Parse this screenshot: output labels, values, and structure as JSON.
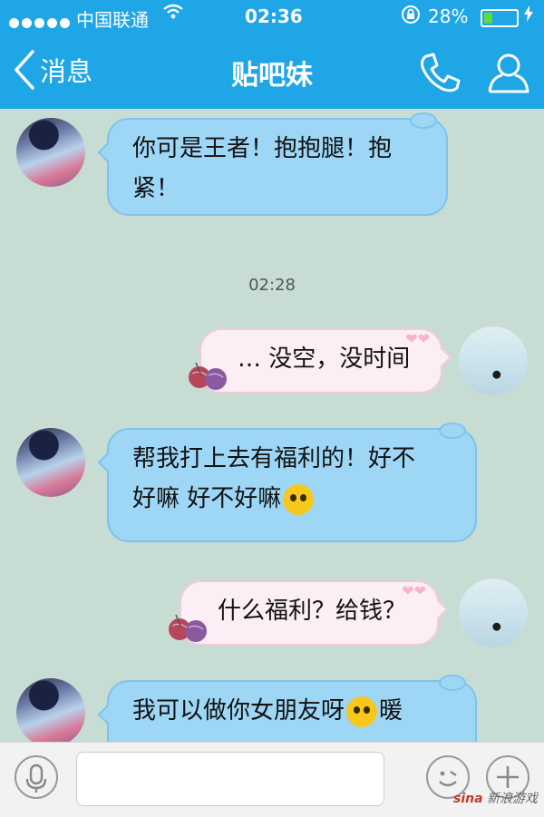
{
  "status_bar": {
    "carrier": "中国联通",
    "time": "02:36",
    "battery_percent": "28%",
    "battery_level": 0.28
  },
  "header": {
    "back_label": "消息",
    "title": "贴吧妹"
  },
  "messages": [
    {
      "from": "her",
      "text": "你可是王者！抱抱腿！抱\n紧！"
    },
    {
      "from": "me",
      "text": "… 没空，没时间"
    },
    {
      "from": "her",
      "text": "帮我打上去有福利的！好不\n好嘛 好不好嘛"
    },
    {
      "from": "me",
      "text": "什么福利？给钱？"
    },
    {
      "from": "her",
      "text": "我可以做你女朋友呀",
      "text_after": "暖"
    }
  ],
  "timestamp": "02:28",
  "watermark": {
    "brand": "sina",
    "text": "新浪游戏"
  },
  "colors": {
    "header_bg": "#1ea6e6",
    "chat_bg": "#c7ddd4",
    "left_bubble": "#9ed6f6",
    "right_bubble": "#fbeef5"
  },
  "icons": [
    "signal-dots-icon",
    "wifi-icon",
    "lock-rotation-icon",
    "battery-icon",
    "charging-icon",
    "back-chevron-icon",
    "phone-icon",
    "profile-icon",
    "microphone-icon",
    "emoji-icon",
    "plus-icon",
    "yarn-ball-icon"
  ]
}
